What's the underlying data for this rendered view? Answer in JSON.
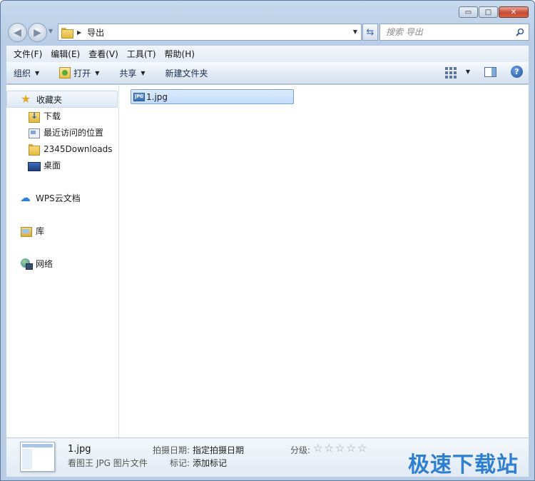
{
  "window": {
    "title": "",
    "caption_buttons": {
      "minimize": "▭",
      "maximize": "□",
      "close": "✕"
    },
    "accent_color": "#2f7fd0"
  },
  "address_bar": {
    "path": "导出",
    "search_placeholder": "搜索 导出"
  },
  "menu": [
    {
      "label": "文件(F)"
    },
    {
      "label": "编辑(E)"
    },
    {
      "label": "查看(V)"
    },
    {
      "label": "工具(T)"
    },
    {
      "label": "帮助(H)"
    }
  ],
  "toolbar": {
    "organize": "组织",
    "open": "打开",
    "share": "共享",
    "new_folder": "新建文件夹"
  },
  "sidebar": {
    "favorites": "收藏夹",
    "favorites_items": [
      {
        "label": "下载",
        "icon": "download-folder-icon"
      },
      {
        "label": "最近访问的位置",
        "icon": "recent-places-icon"
      },
      {
        "label": "2345Downloads",
        "icon": "folder-icon"
      },
      {
        "label": "桌面",
        "icon": "desktop-icon"
      }
    ],
    "wps": "WPS云文档",
    "libraries": "库",
    "network": "网络"
  },
  "files": [
    {
      "name": "1.jpg",
      "icon": "jpg-file-icon",
      "icon_text": "JPG"
    }
  ],
  "details": {
    "name": "1.jpg",
    "type": "看图王 JPG 图片文件",
    "date_label": "拍摄日期:",
    "date_value": "指定拍摄日期",
    "tags_label": "标记:",
    "tags_value": "添加标记",
    "rating_label": "分级:",
    "rating": 0,
    "watermark": "极速下载站"
  }
}
